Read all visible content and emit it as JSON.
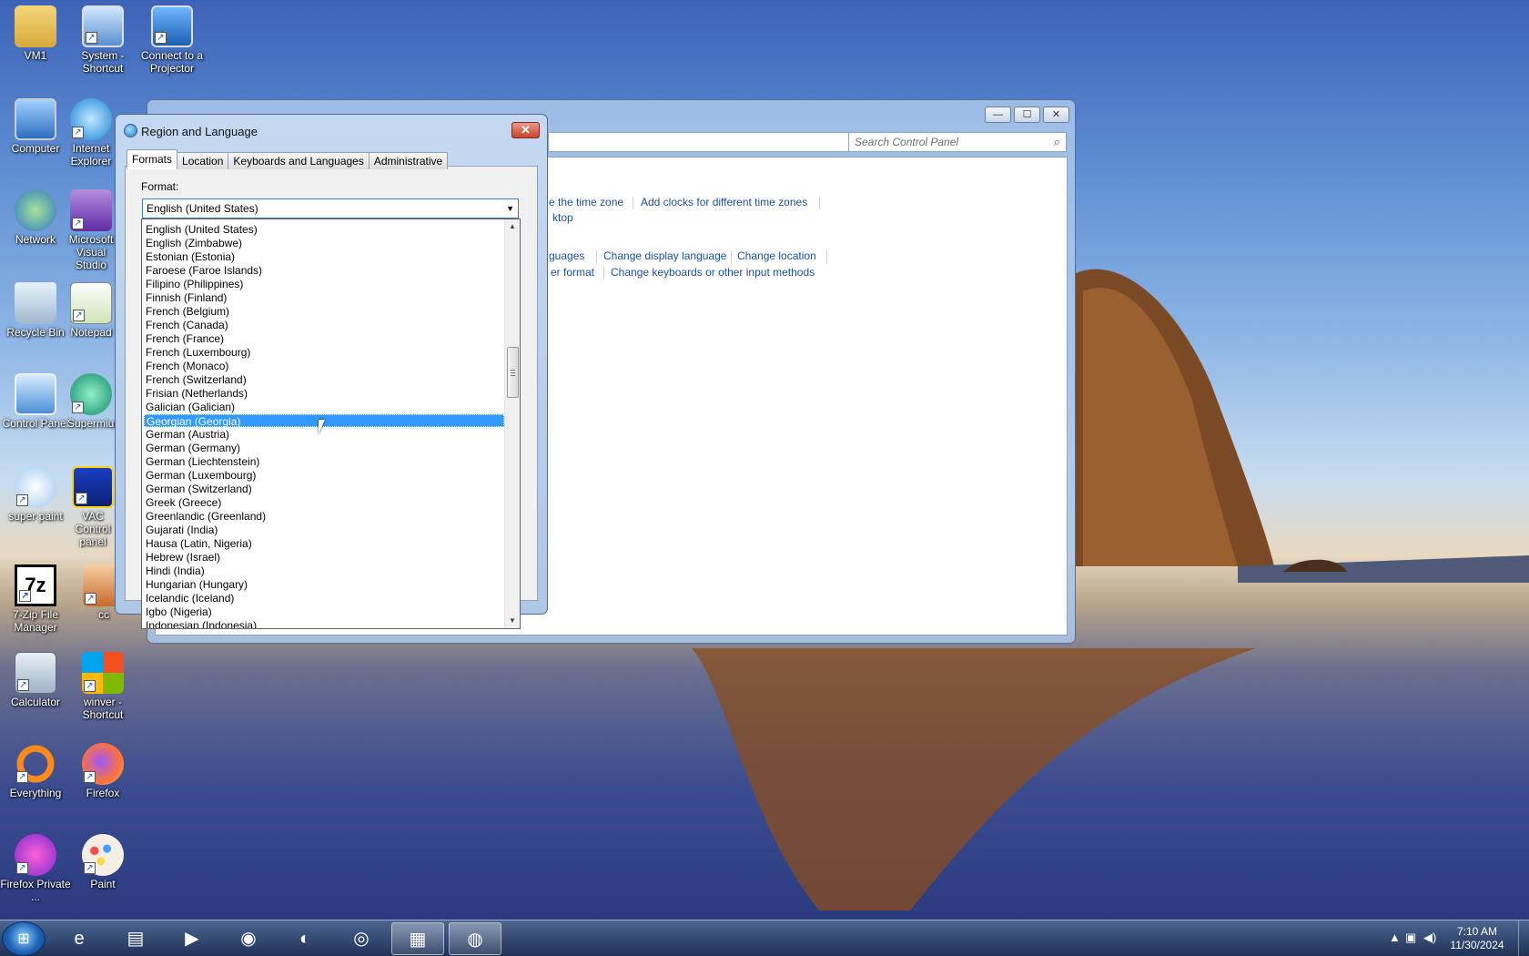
{
  "desktop": {
    "icons": [
      {
        "label": "VM1",
        "icon": "folder-user-icon"
      },
      {
        "label": "System - Shortcut",
        "icon": "system-monitor-icon"
      },
      {
        "label": "Connect to a Projector",
        "icon": "projector-icon"
      },
      {
        "label": "Computer",
        "icon": "computer-icon"
      },
      {
        "label": "Internet Explorer",
        "icon": "internet-explorer-icon"
      },
      {
        "label": "Network",
        "icon": "network-icon"
      },
      {
        "label": "Microsoft Visual Studio",
        "icon": "visual-studio-icon"
      },
      {
        "label": "Recycle Bin",
        "icon": "recycle-bin-icon"
      },
      {
        "label": "Notepad",
        "icon": "notepad-icon"
      },
      {
        "label": "Control Panel",
        "icon": "control-panel-icon"
      },
      {
        "label": "Supermium",
        "icon": "supermium-icon"
      },
      {
        "label": "super paint",
        "icon": "super-paint-icon"
      },
      {
        "label": "VAC Control panel",
        "icon": "vac-control-panel-icon"
      },
      {
        "label": "7-Zip File Manager",
        "icon": "seven-zip-icon"
      },
      {
        "label": "cc",
        "icon": "cc-icon"
      },
      {
        "label": "Calculator",
        "icon": "calculator-icon"
      },
      {
        "label": "winver - Shortcut",
        "icon": "windows-logo-icon"
      },
      {
        "label": "Everything",
        "icon": "everything-search-icon"
      },
      {
        "label": "Firefox",
        "icon": "firefox-icon"
      },
      {
        "label": "Firefox Private ...",
        "icon": "firefox-private-icon"
      },
      {
        "label": "Paint",
        "icon": "paint-icon"
      }
    ]
  },
  "control_panel": {
    "search_placeholder": "Search Control Panel",
    "links_row1": [
      "e the time zone",
      "Add clocks for different time zones"
    ],
    "link_row1b": "ktop",
    "links_row2": [
      "guages",
      "Change display language",
      "Change location"
    ],
    "links_row3": [
      "er format",
      "Change keyboards or other input methods"
    ],
    "window_buttons": {
      "minimize": "—",
      "maximize": "☐",
      "close": "✕"
    }
  },
  "dialog": {
    "title": "Region and Language",
    "close_glyph": "✕",
    "tabs": [
      "Formats",
      "Location",
      "Keyboards and Languages",
      "Administrative"
    ],
    "active_tab": "Formats",
    "format_label": "Format:",
    "format_value": "English (United States)",
    "dropdown_items": [
      "English (United States)",
      "English (Zimbabwe)",
      "Estonian (Estonia)",
      "Faroese (Faroe Islands)",
      "Filipino (Philippines)",
      "Finnish (Finland)",
      "French (Belgium)",
      "French (Canada)",
      "French (France)",
      "French (Luxembourg)",
      "French (Monaco)",
      "French (Switzerland)",
      "Frisian (Netherlands)",
      "Galician (Galician)",
      "Georgian (Georgia)",
      "German (Austria)",
      "German (Germany)",
      "German (Liechtenstein)",
      "German (Luxembourg)",
      "German (Switzerland)",
      "Greek (Greece)",
      "Greenlandic (Greenland)",
      "Gujarati (India)",
      "Hausa (Latin, Nigeria)",
      "Hebrew (Israel)",
      "Hindi (India)",
      "Hungarian (Hungary)",
      "Icelandic (Iceland)",
      "Igbo (Nigeria)",
      "Indonesian (Indonesia)"
    ],
    "highlighted_item": "Georgian (Georgia)"
  },
  "taskbar": {
    "apps": [
      {
        "name": "internet-explorer",
        "glyph": "e"
      },
      {
        "name": "file-explorer",
        "glyph": "▤"
      },
      {
        "name": "media-player",
        "glyph": "▶"
      },
      {
        "name": "firefox",
        "glyph": "◉"
      },
      {
        "name": "supermium",
        "glyph": "◐"
      },
      {
        "name": "firefox-private",
        "glyph": "◎"
      },
      {
        "name": "control-panel",
        "glyph": "▦"
      },
      {
        "name": "region-language",
        "glyph": "◍"
      }
    ],
    "time": "7:10 AM",
    "date": "11/30/2024"
  }
}
